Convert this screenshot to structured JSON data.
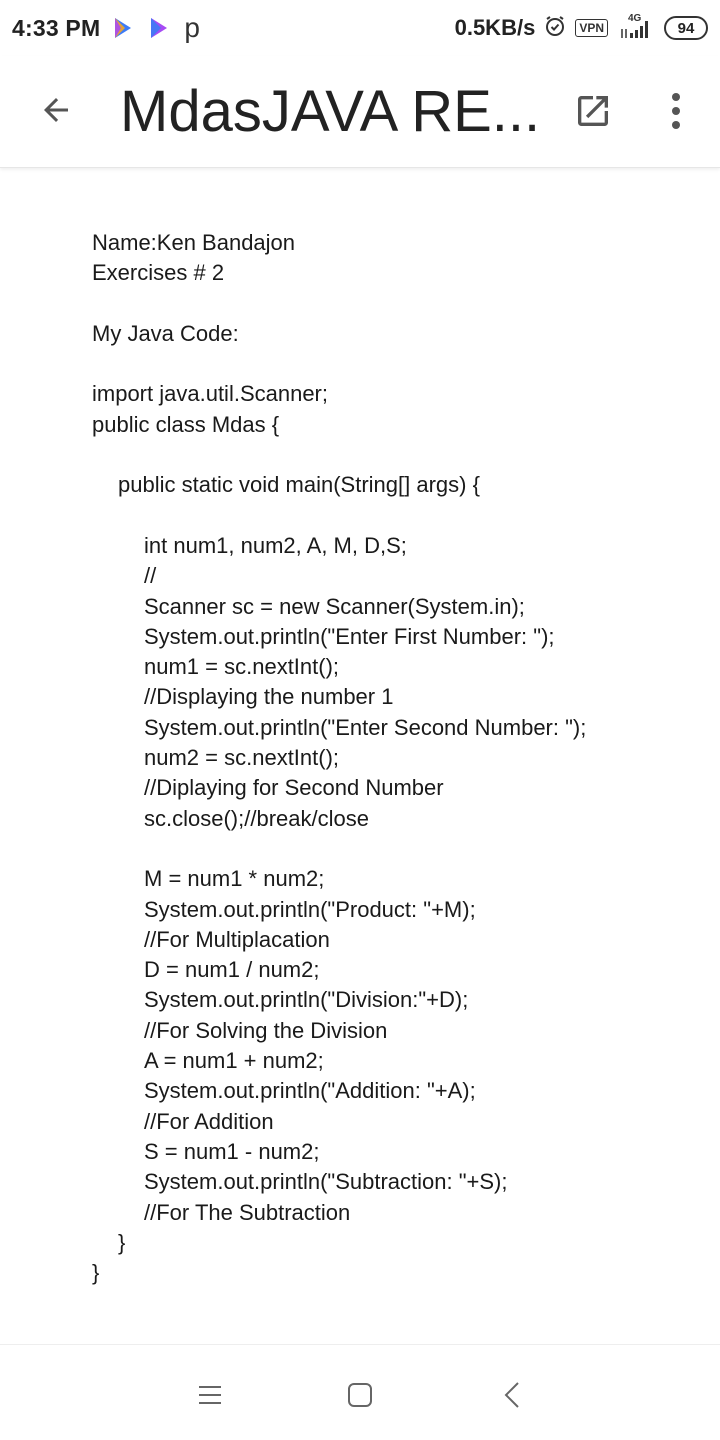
{
  "status_bar": {
    "time": "4:33 PM",
    "p_label": "p",
    "speed": "0.5KB/s",
    "vpn": "VPN",
    "network": "4G",
    "battery": "94"
  },
  "app_bar": {
    "title": "MdasJAVA RE..."
  },
  "document": {
    "name_line": "Name:Ken Bandajon",
    "exercise_line": "Exercises # 2",
    "code_heading": "My Java Code:",
    "code_lines": [
      {
        "text": "import java.util.Scanner;",
        "indent": 0
      },
      {
        "text": "public class Mdas {",
        "indent": 0
      },
      {
        "text": "",
        "indent": 0
      },
      {
        "text": "public static void main(String[] args) {",
        "indent": 1
      },
      {
        "text": "",
        "indent": 0
      },
      {
        "text": "int num1, num2, A, M, D,S;",
        "indent": 2
      },
      {
        "text": "//",
        "indent": 2
      },
      {
        "text": "Scanner sc = new Scanner(System.in);",
        "indent": 2
      },
      {
        "text": "System.out.println(\"Enter First Number: \");",
        "indent": 2
      },
      {
        "text": "num1 = sc.nextInt();",
        "indent": 2
      },
      {
        "text": "//Displaying the number 1",
        "indent": 2
      },
      {
        "text": "System.out.println(\"Enter Second Number: \");",
        "indent": 2
      },
      {
        "text": "num2 = sc.nextInt();",
        "indent": 2
      },
      {
        "text": "//Diplaying for Second Number",
        "indent": 2
      },
      {
        "text": "sc.close();//break/close",
        "indent": 2
      },
      {
        "text": "",
        "indent": 0
      },
      {
        "text": "M = num1 * num2;",
        "indent": 2
      },
      {
        "text": "System.out.println(\"Product: \"+M);",
        "indent": 2
      },
      {
        "text": "//For Multiplacation",
        "indent": 2
      },
      {
        "text": "D = num1 / num2;",
        "indent": 2
      },
      {
        "text": "System.out.println(\"Division:\"+D);",
        "indent": 2
      },
      {
        "text": "//For Solving the Division",
        "indent": 2
      },
      {
        "text": "A = num1 + num2;",
        "indent": 2
      },
      {
        "text": "System.out.println(\"Addition: \"+A);",
        "indent": 2
      },
      {
        "text": "//For Addition",
        "indent": 2
      },
      {
        "text": "S = num1 - num2;",
        "indent": 2
      },
      {
        "text": "System.out.println(\"Subtraction: \"+S);",
        "indent": 2
      },
      {
        "text": "//For The Subtraction",
        "indent": 2
      },
      {
        "text": "}",
        "indent": 1
      },
      {
        "text": "}",
        "indent": 0
      }
    ]
  },
  "icons": {
    "back": "arrow-back-icon",
    "open": "open-in-new-icon",
    "menu": "more-vert-icon",
    "nav_menu": "recents-icon",
    "nav_home": "home-icon",
    "nav_back": "nav-back-icon"
  },
  "colors": {
    "play_blue": "#3d7bf5",
    "play_orange": "#f5a623",
    "play_purple": "#a64bf4",
    "icon_gray": "#555555"
  }
}
